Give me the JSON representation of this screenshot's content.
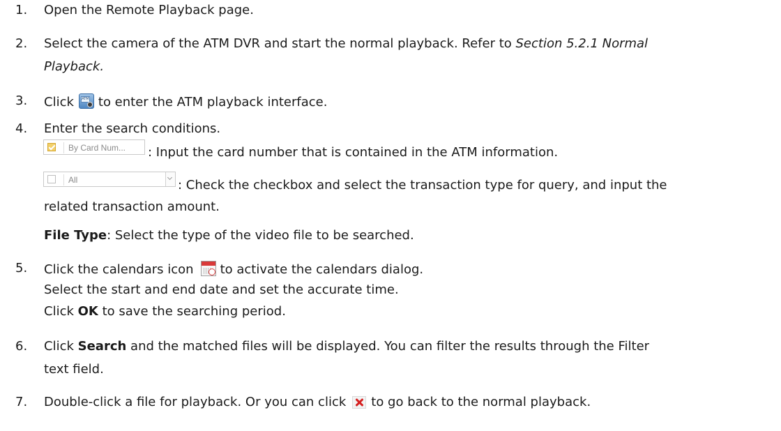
{
  "steps": [
    {
      "num": "1.",
      "text": "Open the Remote Playback page."
    },
    {
      "num": "2.",
      "text_a": "Select the camera of the ATM DVR and start the normal playback. Refer to ",
      "ref_a": "Section 5.2.1 Normal",
      "ref_b": "Playback."
    },
    {
      "num": "3.",
      "pre": "Click",
      "post": "to enter the ATM playback interface."
    },
    {
      "num": "4.",
      "text": "Enter the search conditions."
    },
    {
      "num": "5.",
      "pre": "Click the calendars icon",
      "post": "to activate the calendars dialog."
    },
    {
      "num": "6.",
      "pre": "Click ",
      "bold": "Search",
      "post": " and the matched files will be displayed. You can filter the results through the Filter",
      "line2": "text field."
    },
    {
      "num": "7.",
      "pre": "Double-click a file for playback. Or you can click",
      "post": "to go back to the normal playback."
    }
  ],
  "conditions": {
    "card_widget_text": "By Card Num...",
    "card_desc": ": Input the card number that is contained in the ATM information.",
    "type_widget_text": "All",
    "type_desc": ": Check the checkbox and select the transaction type for query, and input the",
    "type_desc2": "related transaction amount.",
    "file_type_label": "File Type",
    "file_type_desc": ": Select the type of the video file to be searched."
  },
  "calendar": {
    "line1": "Select the start and end date and set the accurate time.",
    "ok_pre": "Click ",
    "ok_bold": "OK",
    "ok_post": " to save the searching period."
  },
  "icons": {
    "atm_icon_text": "ATM",
    "atm": "atm-playback-icon",
    "calendar": "calendar-icon",
    "close": "close-icon"
  }
}
